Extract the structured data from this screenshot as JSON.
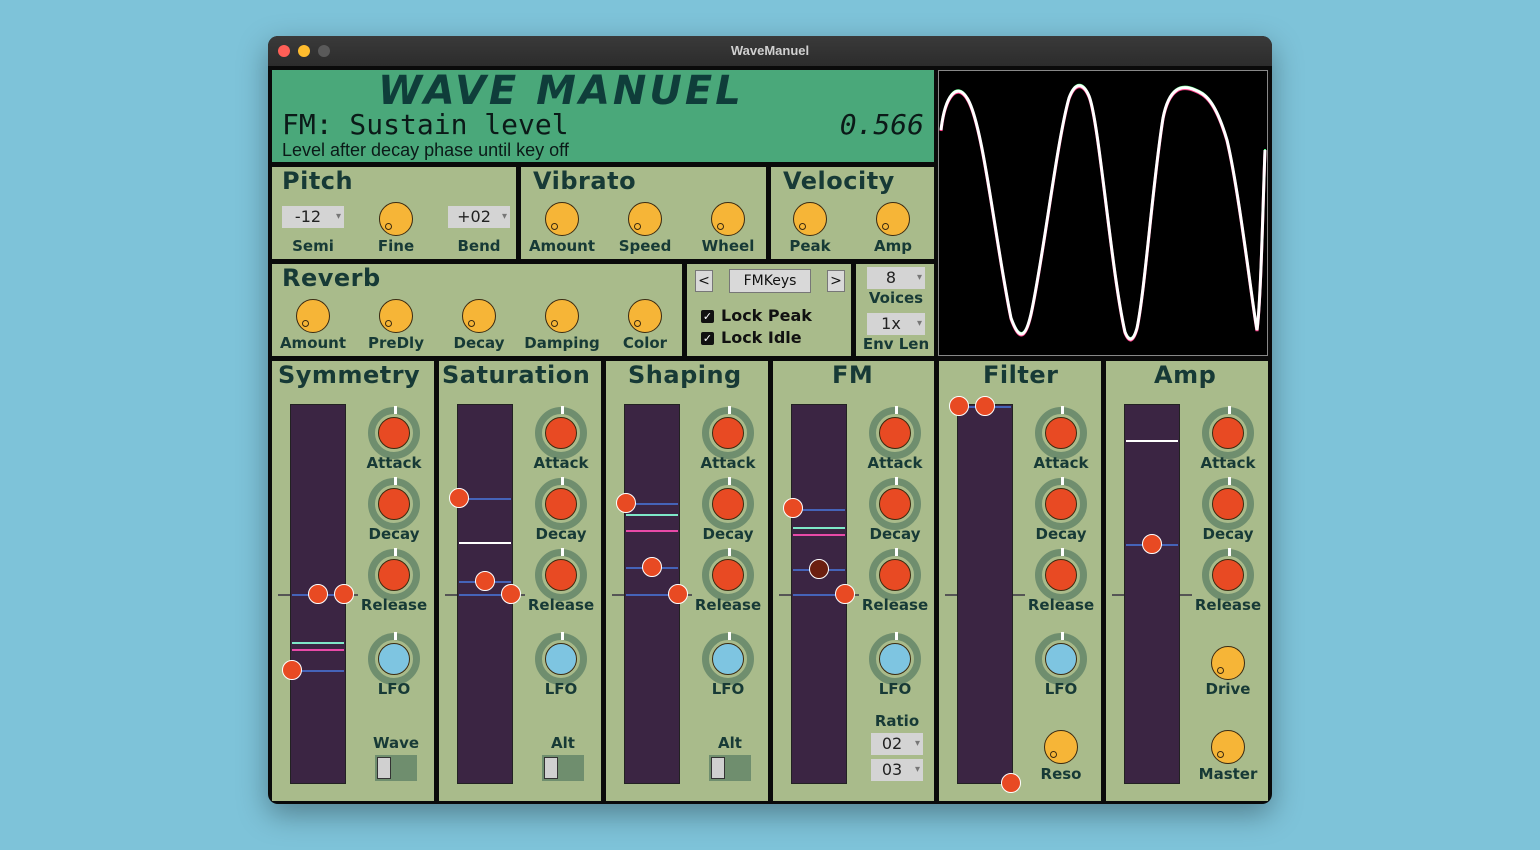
{
  "window": {
    "title": "WaveManuel"
  },
  "header": {
    "logo": "WAVE MANUEL",
    "param": "FM: Sustain level",
    "value": "0.566",
    "description": "Level after decay phase until key off"
  },
  "pitch": {
    "title": "Pitch",
    "semi_value": "-12",
    "semi": "Semi",
    "fine": "Fine",
    "bend_value": "+02",
    "bend": "Bend"
  },
  "vibrato": {
    "title": "Vibrato",
    "amount": "Amount",
    "speed": "Speed",
    "wheel": "Wheel"
  },
  "velocity": {
    "title": "Velocity",
    "peak": "Peak",
    "amp": "Amp"
  },
  "reverb": {
    "title": "Reverb",
    "amount": "Amount",
    "predly": "PreDly",
    "decay": "Decay",
    "damping": "Damping",
    "color": "Color"
  },
  "preset": {
    "prev": "<",
    "name": "FMKeys",
    "next": ">",
    "lock_peak": "Lock Peak",
    "lock_idle": "Lock Idle",
    "lock_peak_checked": true,
    "lock_idle_checked": true
  },
  "voices": {
    "value": "8",
    "label": "Voices",
    "env_value": "1x",
    "env_label": "Env Len"
  },
  "env_labels": {
    "attack": "Attack",
    "decay": "Decay",
    "release": "Release",
    "lfo": "LFO"
  },
  "symmetry": {
    "title": "Symmetry",
    "wave": "Wave"
  },
  "saturation": {
    "title": "Saturation",
    "alt": "Alt"
  },
  "shaping": {
    "title": "Shaping",
    "alt": "Alt"
  },
  "fm": {
    "title": "FM",
    "ratio": "Ratio",
    "ratio1": "02",
    "ratio2": "03"
  },
  "filter": {
    "title": "Filter",
    "reso": "Reso"
  },
  "amp": {
    "title": "Amp",
    "drive": "Drive",
    "master": "Master"
  },
  "colors": {
    "panel": "#a9bb8b",
    "header": "#4aa87a",
    "knob": "#f6b537",
    "env_knob": "#e84a23",
    "lfo_knob": "#7ec5e1",
    "track": "#3b2543"
  }
}
